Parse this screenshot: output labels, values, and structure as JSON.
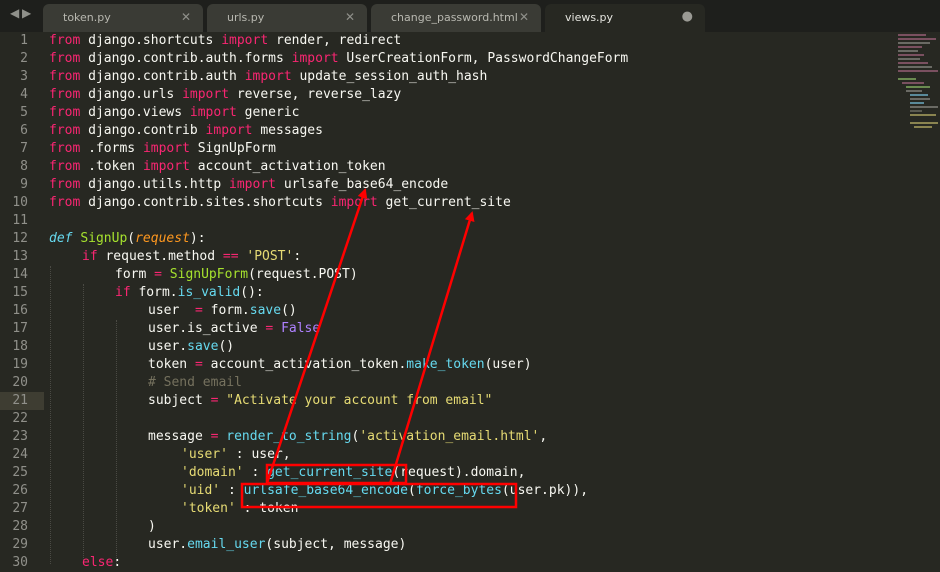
{
  "tabs": [
    {
      "label": "token.py",
      "close": "✕"
    },
    {
      "label": "urls.py",
      "close": "✕"
    },
    {
      "label": "change_password.html",
      "close": "✕"
    },
    {
      "label": "views.py",
      "close": "●"
    }
  ],
  "nav": {
    "left": "◀",
    "right": "▶"
  },
  "line_numbers": [
    "1",
    "2",
    "3",
    "4",
    "5",
    "6",
    "7",
    "8",
    "9",
    "10",
    "11",
    "12",
    "13",
    "14",
    "15",
    "16",
    "17",
    "18",
    "19",
    "20",
    "21",
    "22",
    "23",
    "24",
    "25",
    "26",
    "27",
    "28",
    "29",
    "30"
  ],
  "code": {
    "l1": [
      "from",
      " django.shortcuts ",
      "import",
      " render, redirect"
    ],
    "l2": [
      "from",
      " django.contrib.auth.forms ",
      "import",
      " UserCreationForm, PasswordChangeForm"
    ],
    "l3": [
      "from",
      " django.contrib.auth ",
      "import",
      " update_session_auth_hash"
    ],
    "l4": [
      "from",
      " django.urls ",
      "import",
      " reverse, reverse_lazy"
    ],
    "l5": [
      "from",
      " django.views ",
      "import",
      " generic"
    ],
    "l6": [
      "from",
      " django.contrib ",
      "import",
      " messages"
    ],
    "l7": [
      "from",
      " .forms ",
      "import",
      " SignUpForm"
    ],
    "l8": [
      "from",
      " .token ",
      "import",
      " account_activation_token"
    ],
    "l9": [
      "from",
      " django.utils.http ",
      "import",
      " urlsafe_base64_encode"
    ],
    "l10": [
      "from",
      " django.contrib.sites.shortcuts ",
      "import",
      " get_current_site"
    ],
    "l12": [
      "def",
      " ",
      "SignUp",
      "(",
      "request",
      "):"
    ],
    "l13": [
      "if",
      " request.method ",
      "==",
      " ",
      "'POST'",
      ":"
    ],
    "l14": [
      "form ",
      "=",
      " ",
      "SignUpForm",
      "(request.POST)"
    ],
    "l15": [
      "if",
      " form.",
      "is_valid",
      "():"
    ],
    "l16": [
      "user  ",
      "=",
      " form.",
      "save",
      "()"
    ],
    "l17": [
      "user.is_active ",
      "=",
      " ",
      "False"
    ],
    "l18": [
      "user.",
      "save",
      "()"
    ],
    "l19": [
      "token ",
      "=",
      " account_activation_token.",
      "make_token",
      "(user)"
    ],
    "l20": [
      "# Send email"
    ],
    "l21": [
      "subject ",
      "=",
      " ",
      "\"Activate your account from email\""
    ],
    "l23": [
      "message ",
      "=",
      " ",
      "render_to_string",
      "(",
      "'activation_email.html'",
      ","
    ],
    "l24": [
      "'user'",
      " : user,"
    ],
    "l25": [
      "'domain'",
      " : ",
      "get_current_site",
      "(request).domain,"
    ],
    "l26": [
      "'uid'",
      " : ",
      "urlsafe_base64_encode",
      "(",
      "force_bytes",
      "(user.pk)),"
    ],
    "l27": [
      "'token'",
      " : token"
    ],
    "l28": [
      ")"
    ],
    "l29": [
      "user.",
      "email_user",
      "(subject, message)"
    ],
    "l30": [
      "else",
      ":"
    ]
  },
  "annotation_color": "#ff0000"
}
